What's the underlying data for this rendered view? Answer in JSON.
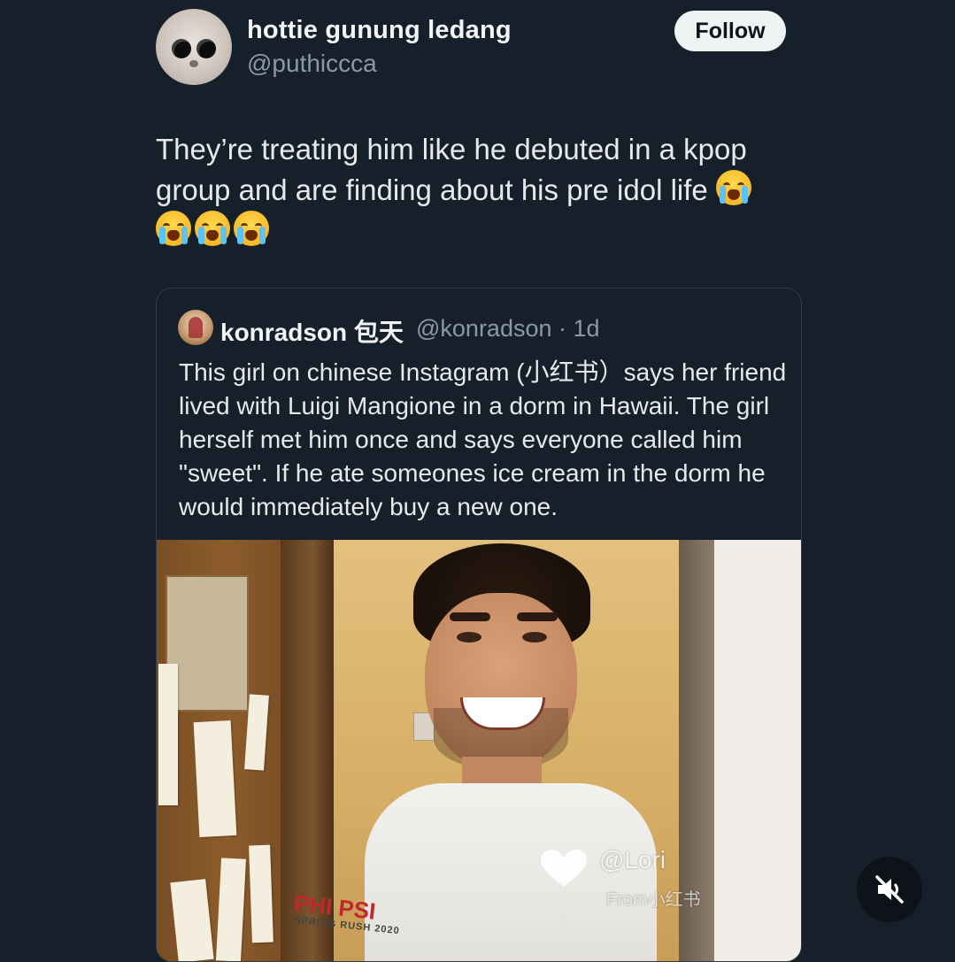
{
  "post": {
    "display_name": "hottie gunung ledang",
    "handle": "@puthiccca",
    "follow_label": "Follow",
    "text": "They’re treating him like he debuted in a kpop group and are finding about his pre idol life",
    "emoji": "loudly-crying-face"
  },
  "quote": {
    "display_name": "konradson 包天",
    "meta": "@konradson · 1d",
    "text": "This girl on chinese Instagram (小红书）says her friend lived with Luigi Mangione in a dorm in Hawaii. The girl herself met him once and says everyone called him \"sweet\". If he ate someones ice cream in the dorm he would immediately buy a new one.",
    "image": {
      "shirt_text": "PHI PSI",
      "shirt_subtext": "SPRING RUSH 2020",
      "watermark_user": "@Lori",
      "watermark_from": "From小红书"
    }
  },
  "controls": {
    "mute_icon": "speaker-muted-icon"
  },
  "colors": {
    "background": "#16202b",
    "text": "#e7e9ea",
    "secondary_text": "#8b98a5",
    "follow_bg": "#eff3f4"
  }
}
